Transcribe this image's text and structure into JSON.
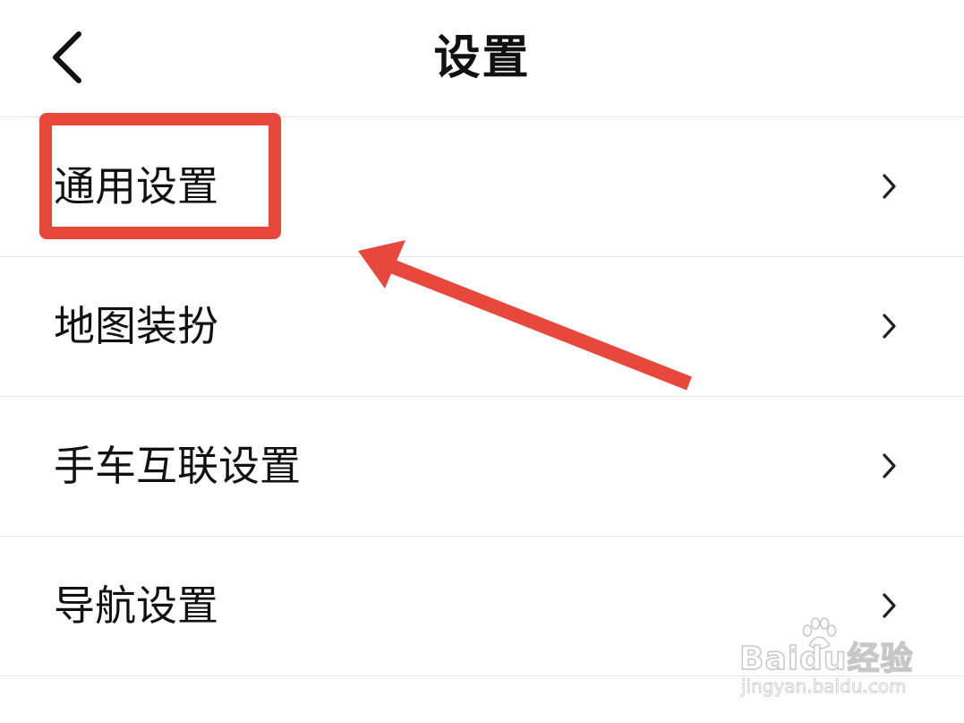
{
  "header": {
    "title": "设置",
    "back_icon": "chevron-left-icon"
  },
  "settings_list": {
    "items": [
      {
        "label": "通用设置",
        "icon": "chevron-right-icon"
      },
      {
        "label": "地图装扮",
        "icon": "chevron-right-icon"
      },
      {
        "label": "手车互联设置",
        "icon": "chevron-right-icon"
      },
      {
        "label": "导航设置",
        "icon": "chevron-right-icon"
      }
    ]
  },
  "annotation": {
    "highlight_color": "#e8473c",
    "highlighted_item": "通用设置"
  },
  "watermark": {
    "logo_text": "Baidu经验",
    "url": "jingyan.baidu.com"
  },
  "colors": {
    "background": "#ffffff",
    "text": "#111111",
    "divider": "#e6e6e6",
    "annotation_red": "#e8473c"
  }
}
